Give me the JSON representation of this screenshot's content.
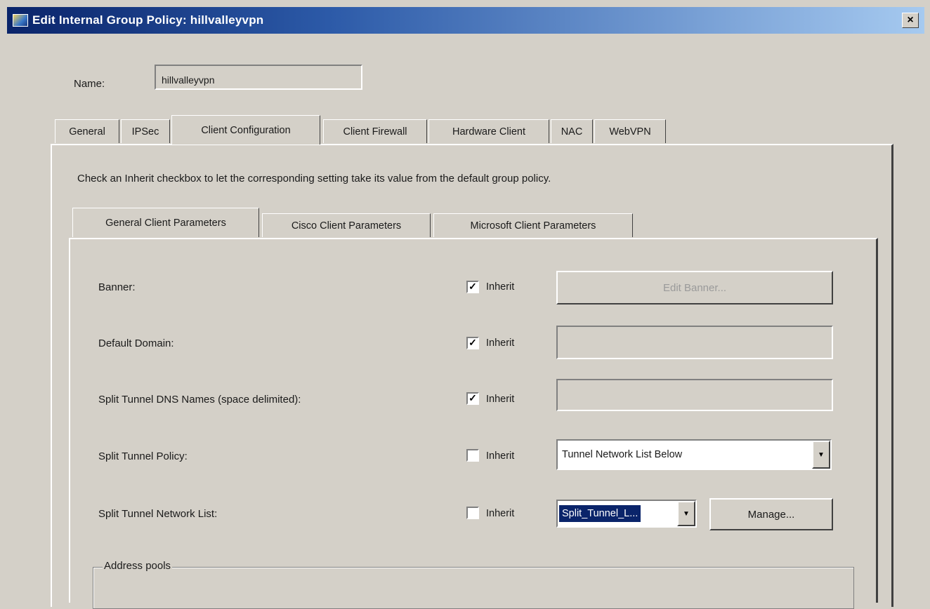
{
  "window": {
    "title": "Edit Internal Group Policy: hillvalleyvpn",
    "icons": {
      "app": "asdm-app-icon",
      "close": "close-icon"
    },
    "close_glyph": "×"
  },
  "name_row": {
    "label": "Name:",
    "value": "hillvalleyvpn"
  },
  "outer_tabs": [
    {
      "label": "General",
      "active": false
    },
    {
      "label": "IPSec",
      "active": false
    },
    {
      "label": "Client Configuration",
      "active": true
    },
    {
      "label": "Client Firewall",
      "active": false
    },
    {
      "label": "Hardware Client",
      "active": false
    },
    {
      "label": "NAC",
      "active": false
    },
    {
      "label": "WebVPN",
      "active": false
    }
  ],
  "instruction": "Check an Inherit checkbox to let the corresponding setting take its value from the default group policy.",
  "inner_tabs": [
    {
      "label": "General Client Parameters",
      "active": true
    },
    {
      "label": "Cisco Client Parameters",
      "active": false
    },
    {
      "label": "Microsoft Client Parameters",
      "active": false
    }
  ],
  "rows": {
    "banner": {
      "label": "Banner:",
      "inherit_label": "Inherit",
      "inherit_checked": true,
      "button": "Edit Banner..."
    },
    "default_domain": {
      "label": "Default Domain:",
      "inherit_label": "Inherit",
      "inherit_checked": true,
      "value": ""
    },
    "split_dns": {
      "label": "Split Tunnel DNS Names (space delimited):",
      "inherit_label": "Inherit",
      "inherit_checked": true,
      "value": ""
    },
    "split_policy": {
      "label": "Split Tunnel Policy:",
      "inherit_label": "Inherit",
      "inherit_checked": false,
      "value": "Tunnel Network List Below"
    },
    "split_list": {
      "label": "Split Tunnel Network List:",
      "inherit_label": "Inherit",
      "inherit_checked": false,
      "value": "Split_Tunnel_L...",
      "button": "Manage..."
    }
  },
  "checkmark_glyph": "✓",
  "dropdown_glyph": "▼",
  "address_pools": {
    "legend": "Address pools"
  },
  "colors": {
    "face": "#d4d0c8",
    "titlebar_start": "#0a246a",
    "titlebar_end": "#a6caf0",
    "selection": "#0a246a"
  }
}
